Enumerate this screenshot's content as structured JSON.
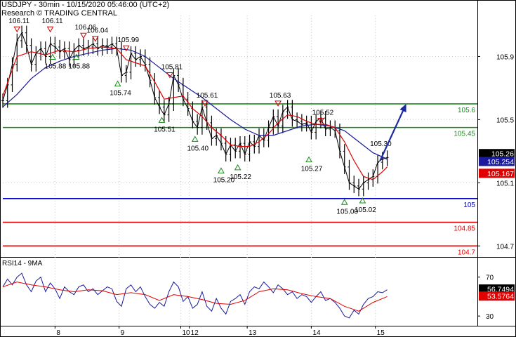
{
  "header": {
    "title": "USDJPY - 30min - 10/15/2020 05:46:00 (UTC+2)",
    "source": "Research © TRADING CENTRAL"
  },
  "colors": {
    "price": "#000000",
    "ma_fast": "#e00000",
    "ma_slow": "#1a1a9a",
    "resistance": "#1a8a1a",
    "support_blue": "#0000b4",
    "support_red": "#e00000",
    "arrow": "#1a2aa0",
    "label_dark_bg": "#000000",
    "label_blue_bg": "#1a1a9a",
    "label_red_bg": "#e00000",
    "grid": "#c8c8c8",
    "pivot_down": "#d00000",
    "pivot_up": "#1a8a1a"
  },
  "chart_data": [
    {
      "type": "line",
      "name": "price",
      "ylim": [
        104.63,
        106.16
      ],
      "x_range": [
        0,
        100
      ],
      "y_ticks": [
        "105.9",
        "105.5",
        "105.1",
        "104.7"
      ],
      "y_tick_values": [
        105.9,
        105.5,
        105.1,
        104.7
      ],
      "x_ticks": [
        {
          "label": "8",
          "x": 11
        },
        {
          "label": "9",
          "x": 24.5
        },
        {
          "label": "10",
          "x": 37.5
        },
        {
          "label": "12",
          "x": 39.3
        },
        {
          "label": "13",
          "x": 51.5
        },
        {
          "label": "14",
          "x": 65
        },
        {
          "label": "15",
          "x": 78.5
        }
      ],
      "price_series": [
        [
          0,
          105.62
        ],
        [
          1,
          105.72
        ],
        [
          2,
          105.85
        ],
        [
          3,
          106.0
        ],
        [
          4,
          106.05
        ],
        [
          5,
          105.97
        ],
        [
          6,
          105.85
        ],
        [
          7,
          105.92
        ],
        [
          8,
          105.95
        ],
        [
          9,
          105.9
        ],
        [
          10,
          105.98
        ],
        [
          11,
          105.96
        ],
        [
          12,
          105.93
        ],
        [
          13,
          105.95
        ],
        [
          14,
          105.88
        ],
        [
          15,
          105.94
        ],
        [
          16,
          105.97
        ],
        [
          17,
          105.95
        ],
        [
          18,
          105.96
        ],
        [
          19,
          105.98
        ],
        [
          20,
          105.95
        ],
        [
          21,
          105.97
        ],
        [
          22,
          105.96
        ],
        [
          23,
          105.98
        ],
        [
          24,
          105.95
        ],
        [
          25,
          105.78
        ],
        [
          26,
          105.8
        ],
        [
          27,
          105.92
        ],
        [
          28,
          105.88
        ],
        [
          29,
          105.9
        ],
        [
          30,
          105.85
        ],
        [
          31,
          105.75
        ],
        [
          32,
          105.64
        ],
        [
          33,
          105.58
        ],
        [
          34,
          105.53
        ],
        [
          35,
          105.6
        ],
        [
          36,
          105.78
        ],
        [
          37,
          105.72
        ],
        [
          38,
          105.63
        ],
        [
          39,
          105.57
        ],
        [
          40,
          105.49
        ],
        [
          41,
          105.45
        ],
        [
          42,
          105.58
        ],
        [
          43,
          105.48
        ],
        [
          44,
          105.38
        ],
        [
          45,
          105.4
        ],
        [
          46,
          105.35
        ],
        [
          47,
          105.28
        ],
        [
          48,
          105.34
        ],
        [
          49,
          105.3
        ],
        [
          50,
          105.35
        ],
        [
          51,
          105.28
        ],
        [
          52,
          105.36
        ],
        [
          53,
          105.33
        ],
        [
          54,
          105.4
        ],
        [
          55,
          105.37
        ],
        [
          56,
          105.45
        ],
        [
          57,
          105.52
        ],
        [
          58,
          105.46
        ],
        [
          59,
          105.55
        ],
        [
          60,
          105.58
        ],
        [
          61,
          105.5
        ],
        [
          62,
          105.49
        ],
        [
          63,
          105.47
        ],
        [
          64,
          105.48
        ],
        [
          65,
          105.42
        ],
        [
          66,
          105.49
        ],
        [
          67,
          105.51
        ],
        [
          68,
          105.44
        ],
        [
          69,
          105.45
        ],
        [
          70,
          105.43
        ],
        [
          71,
          105.3
        ],
        [
          72,
          105.2
        ],
        [
          73,
          105.1
        ],
        [
          74,
          105.08
        ],
        [
          75,
          105.06
        ],
        [
          76,
          105.1
        ],
        [
          77,
          105.12
        ],
        [
          78,
          105.14
        ],
        [
          79,
          105.23
        ],
        [
          80,
          105.25
        ],
        [
          81,
          105.26
        ]
      ],
      "ma_fast_series": [
        [
          0,
          105.65
        ],
        [
          3,
          105.9
        ],
        [
          6,
          105.93
        ],
        [
          9,
          105.91
        ],
        [
          12,
          105.94
        ],
        [
          15,
          105.93
        ],
        [
          18,
          105.95
        ],
        [
          21,
          105.96
        ],
        [
          24,
          105.95
        ],
        [
          26,
          105.88
        ],
        [
          28,
          105.86
        ],
        [
          30,
          105.84
        ],
        [
          32,
          105.74
        ],
        [
          34,
          105.63
        ],
        [
          36,
          105.64
        ],
        [
          38,
          105.65
        ],
        [
          40,
          105.57
        ],
        [
          42,
          105.52
        ],
        [
          44,
          105.45
        ],
        [
          46,
          105.4
        ],
        [
          48,
          105.34
        ],
        [
          50,
          105.33
        ],
        [
          52,
          105.33
        ],
        [
          54,
          105.36
        ],
        [
          56,
          105.41
        ],
        [
          58,
          105.48
        ],
        [
          60,
          105.53
        ],
        [
          62,
          105.52
        ],
        [
          64,
          105.49
        ],
        [
          66,
          105.47
        ],
        [
          68,
          105.47
        ],
        [
          70,
          105.45
        ],
        [
          72,
          105.36
        ],
        [
          74,
          105.24
        ],
        [
          76,
          105.14
        ],
        [
          78,
          105.12
        ],
        [
          80,
          105.17
        ],
        [
          81,
          105.2
        ]
      ],
      "ma_slow_series": [
        [
          0,
          105.58
        ],
        [
          3,
          105.66
        ],
        [
          6,
          105.76
        ],
        [
          9,
          105.83
        ],
        [
          12,
          105.87
        ],
        [
          15,
          105.9
        ],
        [
          18,
          105.92
        ],
        [
          21,
          105.94
        ],
        [
          24,
          105.95
        ],
        [
          27,
          105.94
        ],
        [
          30,
          105.9
        ],
        [
          33,
          105.83
        ],
        [
          36,
          105.76
        ],
        [
          39,
          105.7
        ],
        [
          42,
          105.64
        ],
        [
          45,
          105.57
        ],
        [
          48,
          105.5
        ],
        [
          51,
          105.44
        ],
        [
          54,
          105.4
        ],
        [
          57,
          105.4
        ],
        [
          60,
          105.43
        ],
        [
          63,
          105.46
        ],
        [
          66,
          105.47
        ],
        [
          69,
          105.46
        ],
        [
          72,
          105.43
        ],
        [
          75,
          105.36
        ],
        [
          78,
          105.29
        ],
        [
          81,
          105.25
        ]
      ],
      "pivots": [
        {
          "label": "106.11",
          "x": 3,
          "y": 106.07,
          "type": "down"
        },
        {
          "label": "106.11",
          "x": 10,
          "y": 106.07,
          "type": "down"
        },
        {
          "label": "106.06",
          "x": 17,
          "y": 106.03,
          "type": "down"
        },
        {
          "label": "106.04",
          "x": 19.5,
          "y": 106.01,
          "type": "down"
        },
        {
          "label": "105.99",
          "x": 26,
          "y": 105.95,
          "type": "down"
        },
        {
          "label": "105.81",
          "x": 35.2,
          "y": 105.78,
          "type": "down"
        },
        {
          "label": "105.61",
          "x": 42.6,
          "y": 105.6,
          "type": "down"
        },
        {
          "label": "105.63",
          "x": 58,
          "y": 105.6,
          "type": "down"
        },
        {
          "label": "105.52",
          "x": 67,
          "y": 105.49,
          "type": "down"
        },
        {
          "label": "105.30",
          "x": 79.2,
          "y": 105.32,
          "type": "label"
        },
        {
          "label": "105.88",
          "x": 10.5,
          "y": 105.9,
          "type": "up"
        },
        {
          "label": "105.88",
          "x": 15.5,
          "y": 105.9,
          "type": "up"
        },
        {
          "label": "105.74",
          "x": 24.2,
          "y": 105.73,
          "type": "up"
        },
        {
          "label": "105.51",
          "x": 33.5,
          "y": 105.5,
          "type": "up"
        },
        {
          "label": "105.40",
          "x": 40.5,
          "y": 105.38,
          "type": "up"
        },
        {
          "label": "105.20",
          "x": 46,
          "y": 105.18,
          "type": "up"
        },
        {
          "label": "105.22",
          "x": 49.5,
          "y": 105.2,
          "type": "up"
        },
        {
          "label": "105.27",
          "x": 64.5,
          "y": 105.25,
          "type": "up"
        },
        {
          "label": "105.00",
          "x": 72,
          "y": 104.98,
          "type": "up"
        },
        {
          "label": "105.02",
          "x": 75.8,
          "y": 104.99,
          "type": "up"
        }
      ],
      "levels": [
        {
          "label": "105.6",
          "value": 105.6,
          "color": "resistance"
        },
        {
          "label": "105.45",
          "value": 105.45,
          "color": "resistance"
        },
        {
          "label": "105",
          "value": 105.0,
          "color": "support_blue"
        },
        {
          "label": "104.85",
          "value": 104.85,
          "color": "support_red"
        },
        {
          "label": "104.7",
          "value": 104.7,
          "color": "support_red"
        }
      ],
      "projection_arrow": {
        "from": [
          79.5,
          105.24
        ],
        "to": [
          85,
          105.6
        ]
      },
      "right_labels": [
        {
          "text": "105.26",
          "value": 105.285,
          "bg": "label_dark_bg"
        },
        {
          "text": "105.254",
          "value": 105.235,
          "bg": "label_blue_bg"
        },
        {
          "text": "105.167",
          "value": 105.16,
          "bg": "label_red_bg"
        }
      ]
    },
    {
      "type": "line",
      "name": "RSI14 - 9MA",
      "ylim": [
        20,
        90
      ],
      "y_ticks": [
        "70",
        "30"
      ],
      "y_tick_values": [
        70,
        30
      ],
      "rsi_series": [
        [
          0,
          60
        ],
        [
          1,
          68
        ],
        [
          2,
          62
        ],
        [
          3,
          70
        ],
        [
          4,
          74
        ],
        [
          5,
          62
        ],
        [
          6,
          55
        ],
        [
          7,
          66
        ],
        [
          8,
          70
        ],
        [
          9,
          55
        ],
        [
          10,
          64
        ],
        [
          11,
          58
        ],
        [
          12,
          48
        ],
        [
          13,
          60
        ],
        [
          14,
          55
        ],
        [
          15,
          52
        ],
        [
          16,
          60
        ],
        [
          17,
          62
        ],
        [
          18,
          55
        ],
        [
          19,
          58
        ],
        [
          20,
          52
        ],
        [
          21,
          56
        ],
        [
          22,
          60
        ],
        [
          23,
          58
        ],
        [
          24,
          45
        ],
        [
          25,
          40
        ],
        [
          26,
          58
        ],
        [
          27,
          62
        ],
        [
          28,
          55
        ],
        [
          29,
          60
        ],
        [
          30,
          50
        ],
        [
          31,
          42
        ],
        [
          32,
          38
        ],
        [
          33,
          44
        ],
        [
          34,
          40
        ],
        [
          35,
          55
        ],
        [
          36,
          65
        ],
        [
          37,
          60
        ],
        [
          38,
          45
        ],
        [
          39,
          50
        ],
        [
          40,
          38
        ],
        [
          41,
          42
        ],
        [
          42,
          55
        ],
        [
          43,
          40
        ],
        [
          44,
          35
        ],
        [
          45,
          48
        ],
        [
          46,
          38
        ],
        [
          47,
          32
        ],
        [
          48,
          45
        ],
        [
          49,
          48
        ],
        [
          50,
          52
        ],
        [
          51,
          42
        ],
        [
          52,
          55
        ],
        [
          53,
          60
        ],
        [
          54,
          58
        ],
        [
          55,
          65
        ],
        [
          56,
          60
        ],
        [
          57,
          54
        ],
        [
          58,
          62
        ],
        [
          59,
          58
        ],
        [
          60,
          52
        ],
        [
          61,
          55
        ],
        [
          62,
          48
        ],
        [
          63,
          52
        ],
        [
          64,
          50
        ],
        [
          65,
          44
        ],
        [
          66,
          50
        ],
        [
          67,
          55
        ],
        [
          68,
          46
        ],
        [
          69,
          48
        ],
        [
          70,
          44
        ],
        [
          71,
          38
        ],
        [
          72,
          30
        ],
        [
          73,
          28
        ],
        [
          74,
          36
        ],
        [
          75,
          32
        ],
        [
          76,
          42
        ],
        [
          77,
          48
        ],
        [
          78,
          50
        ],
        [
          79,
          55
        ],
        [
          80,
          54
        ],
        [
          81,
          57
        ]
      ],
      "rsi_ma_series": [
        [
          0,
          60
        ],
        [
          3,
          65
        ],
        [
          6,
          62
        ],
        [
          9,
          60
        ],
        [
          12,
          57
        ],
        [
          15,
          55
        ],
        [
          18,
          57
        ],
        [
          21,
          56
        ],
        [
          24,
          52
        ],
        [
          27,
          54
        ],
        [
          30,
          52
        ],
        [
          33,
          46
        ],
        [
          36,
          52
        ],
        [
          39,
          50
        ],
        [
          42,
          47
        ],
        [
          45,
          43
        ],
        [
          48,
          42
        ],
        [
          51,
          46
        ],
        [
          54,
          55
        ],
        [
          57,
          58
        ],
        [
          60,
          57
        ],
        [
          63,
          53
        ],
        [
          66,
          50
        ],
        [
          69,
          48
        ],
        [
          72,
          40
        ],
        [
          75,
          35
        ],
        [
          78,
          44
        ],
        [
          81,
          50
        ]
      ],
      "right_labels": [
        {
          "text": "56.7494",
          "value": 57.8,
          "bg": "label_dark_bg"
        },
        {
          "text": "53.5764",
          "value": 50.5,
          "bg": "label_red_bg"
        }
      ]
    }
  ]
}
